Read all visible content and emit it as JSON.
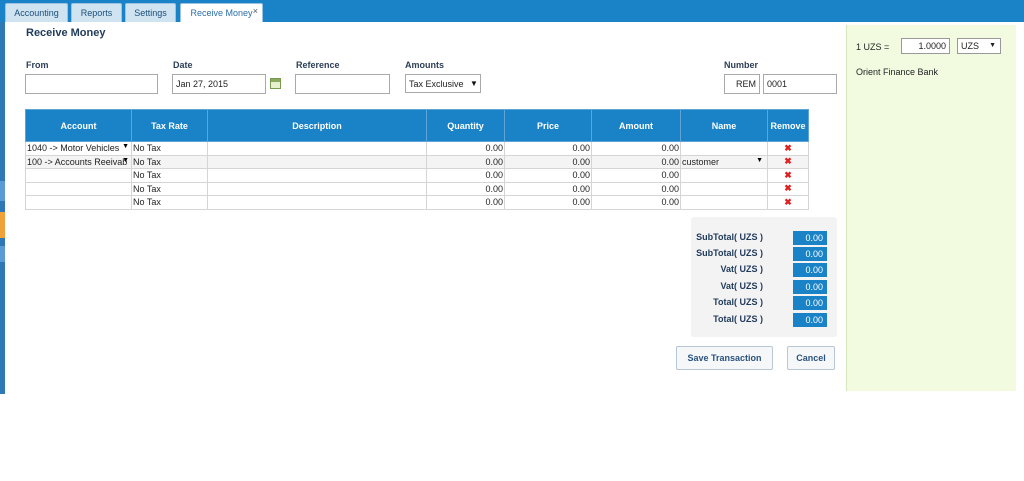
{
  "tabs": [
    {
      "label": "Accounting"
    },
    {
      "label": "Reports"
    },
    {
      "label": "Settings"
    },
    {
      "label": "Receive Money",
      "close": "×"
    }
  ],
  "page_title": "Receive Money",
  "form": {
    "from_label": "From",
    "from_value": "",
    "date_label": "Date",
    "date_value": "Jan 27, 2015",
    "reference_label": "Reference",
    "reference_value": "",
    "amounts_label": "Amounts",
    "amounts_value": "Tax Exclusive",
    "number_label": "Number",
    "number_prefix": "REM",
    "number_value": "0001"
  },
  "table": {
    "headers": [
      "Account",
      "Tax Rate",
      "Description",
      "Quantity",
      "Price",
      "Amount",
      "Name",
      "Remove"
    ],
    "rows": [
      {
        "account": "1040 -> Motor Vehicles",
        "tax": "No Tax",
        "description": "",
        "quantity": "0.00",
        "price": "0.00",
        "amount": "0.00",
        "name": "",
        "remove": "✖"
      },
      {
        "account": "100 -> Accounts Reeivab",
        "tax": "No Tax",
        "description": "",
        "quantity": "0.00",
        "price": "0.00",
        "amount": "0.00",
        "name": "customer",
        "remove": "✖"
      },
      {
        "account": "",
        "tax": "No Tax",
        "description": "",
        "quantity": "0.00",
        "price": "0.00",
        "amount": "0.00",
        "name": "",
        "remove": "✖"
      },
      {
        "account": "",
        "tax": "No Tax",
        "description": "",
        "quantity": "0.00",
        "price": "0.00",
        "amount": "0.00",
        "name": "",
        "remove": "✖"
      },
      {
        "account": "",
        "tax": "No Tax",
        "description": "",
        "quantity": "0.00",
        "price": "0.00",
        "amount": "0.00",
        "name": "",
        "remove": "✖"
      }
    ]
  },
  "totals": [
    {
      "label": "SubTotal( UZS )",
      "value": "0.00"
    },
    {
      "label": "SubTotal( UZS )",
      "value": "0.00"
    },
    {
      "label": "Vat( UZS )",
      "value": "0.00"
    },
    {
      "label": "Vat( UZS )",
      "value": "0.00"
    },
    {
      "label": "Total( UZS )",
      "value": "0.00"
    },
    {
      "label": "Total( UZS )",
      "value": "0.00"
    }
  ],
  "buttons": {
    "save": "Save Transaction",
    "cancel": "Cancel"
  },
  "rate_panel": {
    "rate_label": "1 UZS =",
    "rate_value": "1.0000",
    "currency": "UZS",
    "bank": "Orient Finance Bank"
  },
  "colors": {
    "accent": "#1a82c6",
    "panel": "#f2fbe0",
    "remove": "#e02020"
  }
}
